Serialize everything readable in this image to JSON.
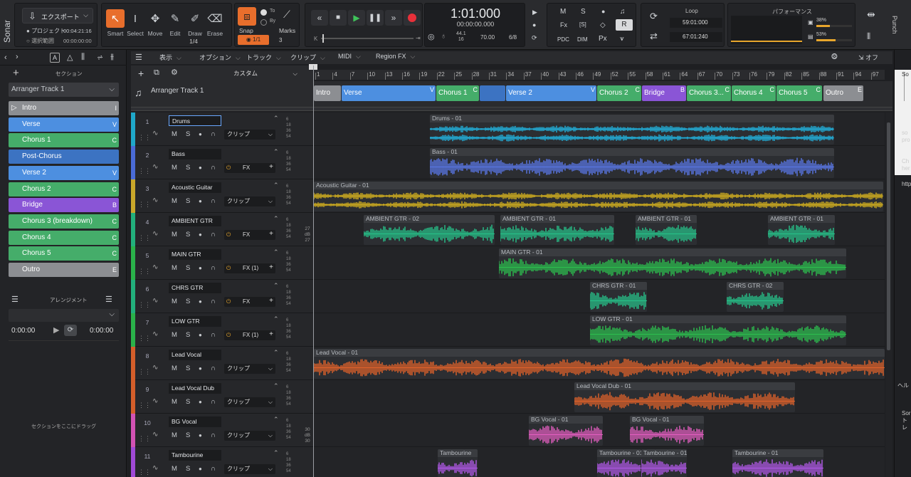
{
  "app": {
    "name": "Sonar"
  },
  "export": {
    "label": "エクスポート"
  },
  "project": {
    "label1": "プロジェクト",
    "time1": "00:04:21:16",
    "label2": "選択範囲",
    "time2": "00:00:00:00"
  },
  "tools": [
    {
      "label": "Smart",
      "icon": "smart-tool-icon"
    },
    {
      "label": "Select",
      "icon": "select-tool-icon"
    },
    {
      "label": "Move",
      "icon": "move-tool-icon"
    },
    {
      "label": "Edit",
      "icon": "edit-tool-icon"
    },
    {
      "label": "Draw",
      "icon": "draw-tool-icon"
    },
    {
      "label": "Erase",
      "icon": "erase-tool-icon"
    }
  ],
  "tool_sub": {
    "fraction": "1/4"
  },
  "snap": {
    "label": "Snap",
    "value": "1/1",
    "to": "To",
    "by": "By",
    "marks": "Marks",
    "count": "3"
  },
  "transport": {
    "time": "1:01:000",
    "timecode": "00:00:00.000",
    "rate_top": "44.1",
    "rate_bottom": "16",
    "tempo": "70.00",
    "meter": "6/8"
  },
  "mixer_flags": {
    "m": "M",
    "s": "S",
    "pdc": "PDC",
    "dim": "DIM",
    "px": "Px",
    "r": "R",
    "fx": "Fx",
    "s_box": "[S]"
  },
  "loop": {
    "label": "Loop",
    "start": "59:01:000",
    "end": "67:01:240"
  },
  "perf": {
    "label": "パフォーマンス",
    "cpu": "38%",
    "disk": "53%",
    "cpu_level": 0.38,
    "disk_level": 0.53
  },
  "right_labels": {
    "punch": "Punch"
  },
  "left_panel": {
    "title": "セクション",
    "dropdown": "Arranger Track 1",
    "sections": [
      {
        "label": "Intro",
        "key": "I",
        "color": "#8c8e92"
      },
      {
        "label": "Verse",
        "key": "V",
        "color": "#4d8fe0"
      },
      {
        "label": "Chorus 1",
        "key": "C",
        "color": "#45ad6a"
      },
      {
        "label": "Post-Chorus",
        "key": "",
        "color": "#3c73c2"
      },
      {
        "label": "Verse 2",
        "key": "V",
        "color": "#4d8fe0"
      },
      {
        "label": "Chorus 2",
        "key": "C",
        "color": "#45ad6a"
      },
      {
        "label": "Bridge",
        "key": "B",
        "color": "#8a55d6"
      },
      {
        "label": "Chorus 3 (breakdown)",
        "key": "C",
        "color": "#45ad6a"
      },
      {
        "label": "Chorus 4",
        "key": "C",
        "color": "#45ad6a"
      },
      {
        "label": "Chorus 5",
        "key": "C",
        "color": "#45ad6a"
      },
      {
        "label": "Outro",
        "key": "E",
        "color": "#8c8e92"
      }
    ],
    "arrangement_title": "アレンジメント",
    "time_start": "0:00:00",
    "time_end": "0:00:00",
    "drop_hint": "セクションをここにドラッグ"
  },
  "menus": [
    {
      "label": "表示"
    },
    {
      "label": "オプション"
    },
    {
      "label": "トラック"
    },
    {
      "label": "クリップ"
    },
    {
      "label": "MIDI"
    },
    {
      "label": "Region FX"
    }
  ],
  "view_preset": "カスタム",
  "off_label": "オフ",
  "arranger_track": {
    "name": "Arranger Track 1"
  },
  "arranger_sections": [
    {
      "label": "Intro",
      "key": "",
      "color": "#8c8e92"
    },
    {
      "label": "Verse",
      "key": "V",
      "color": "#4d8fe0"
    },
    {
      "label": "Chorus 1",
      "key": "C",
      "color": "#45ad6a"
    },
    {
      "label": "",
      "key": "",
      "color": "#3c73c2"
    },
    {
      "label": "Verse 2",
      "key": "V",
      "color": "#4d8fe0"
    },
    {
      "label": "Chorus 2",
      "key": "C",
      "color": "#45ad6a"
    },
    {
      "label": "Bridge",
      "key": "B",
      "color": "#8a55d6"
    },
    {
      "label": "Chorus 3...",
      "key": "C",
      "color": "#45ad6a"
    },
    {
      "label": "Chorus 4",
      "key": "C",
      "color": "#45ad6a"
    },
    {
      "label": "Chorus 5",
      "key": "C",
      "color": "#45ad6a"
    },
    {
      "label": "Outro",
      "key": "E",
      "color": "#8c8e92"
    }
  ],
  "ruler": [
    "1",
    "4",
    "7",
    "10",
    "13",
    "16",
    "19",
    "22",
    "25",
    "28",
    "31",
    "34",
    "37",
    "40",
    "43",
    "46",
    "49",
    "52",
    "55",
    "58",
    "61",
    "64",
    "67",
    "70",
    "73",
    "76",
    "79",
    "82",
    "85",
    "88",
    "91",
    "94",
    "97"
  ],
  "tracks": [
    {
      "num": "1",
      "name": "Drums",
      "color": "#1fa8c9",
      "slot": "クリップ",
      "fx": false
    },
    {
      "num": "2",
      "name": "Bass",
      "color": "#4a6bd6",
      "slot": "FX",
      "fx": true
    },
    {
      "num": "3",
      "name": "Acoustic Guitar",
      "color": "#c9a72a",
      "slot": "クリップ",
      "fx": false
    },
    {
      "num": "4",
      "name": "AMBIENT GTR",
      "color": "#22b07c",
      "slot": "FX",
      "fx": true
    },
    {
      "num": "5",
      "name": "MAIN GTR",
      "color": "#2ab24a",
      "slot": "FX (1)",
      "fx": true
    },
    {
      "num": "6",
      "name": "CHRS GTR",
      "color": "#22b07c",
      "slot": "FX",
      "fx": true
    },
    {
      "num": "7",
      "name": "LOW GTR",
      "color": "#2ab24a",
      "slot": "FX (1)",
      "fx": true
    },
    {
      "num": "8",
      "name": "Lead Vocal",
      "color": "#d45e2a",
      "slot": "クリップ",
      "fx": false
    },
    {
      "num": "9",
      "name": "Lead Vocal Dub",
      "color": "#d45e2a",
      "slot": "クリップ",
      "fx": false
    },
    {
      "num": "10",
      "name": "BG Vocal",
      "color": "#d252b4",
      "slot": "クリップ",
      "fx": false
    },
    {
      "num": "11",
      "name": "Tambourine",
      "color": "#a04ad6",
      "slot": "クリップ",
      "fx": false
    }
  ],
  "track_buttons": {
    "m": "M",
    "s": "S"
  },
  "meter_labels": {
    "a": "27",
    "b": "dB",
    "c": "27",
    "d": "30",
    "e": "dB",
    "f": "30"
  },
  "clips": [
    {
      "lane": 0,
      "name": "Drums - 01",
      "color": "#22b4e0"
    },
    {
      "lane": 1,
      "name": "Bass - 01",
      "color": "#5a78e8"
    },
    {
      "lane": 2,
      "name": "Acoustic Guitar - 01",
      "color": "#d6b21e"
    },
    {
      "lane": 3,
      "name": "AMBIENT GTR - 02",
      "color": "#26c48a"
    },
    {
      "lane": 3,
      "name": "AMBIENT GTR - 01",
      "color": "#26c48a"
    },
    {
      "lane": 3,
      "name": "AMBIENT GTR - 01",
      "color": "#26c48a"
    },
    {
      "lane": 3,
      "name": "AMBIENT GTR - 01",
      "color": "#26c48a"
    },
    {
      "lane": 4,
      "name": "MAIN GTR - 01",
      "color": "#2cc04e"
    },
    {
      "lane": 5,
      "name": "CHRS GTR - 01",
      "color": "#26c48a"
    },
    {
      "lane": 5,
      "name": "CHRS GTR - 02",
      "color": "#26c48a"
    },
    {
      "lane": 6,
      "name": "LOW GTR - 01",
      "color": "#2cc04e"
    },
    {
      "lane": 7,
      "name": "Lead Vocal - 01",
      "color": "#e0622a"
    },
    {
      "lane": 8,
      "name": "Lead Vocal Dub - 01",
      "color": "#e0622a"
    },
    {
      "lane": 9,
      "name": "BG Vocal - 01",
      "color": "#e45ec0"
    },
    {
      "lane": 9,
      "name": "BG Vocal - 01",
      "color": "#e45ec0"
    },
    {
      "lane": 10,
      "name": "Tambourine",
      "color": "#b058e6"
    },
    {
      "lane": 10,
      "name": "Tambourine - 01",
      "color": "#b058e6"
    },
    {
      "lane": 10,
      "name": "Tambourine - 01",
      "color": "#b058e6"
    },
    {
      "lane": 10,
      "name": "Tambourine - 01",
      "color": "#b058e6"
    }
  ],
  "right_panel": {
    "t1": "So",
    "t2": "so",
    "t3": "pro",
    "t4": "Ch",
    "t5": "her",
    "t6": "http",
    "t7": "ヘル",
    "t8": "Sor",
    "t9": "トレ"
  }
}
